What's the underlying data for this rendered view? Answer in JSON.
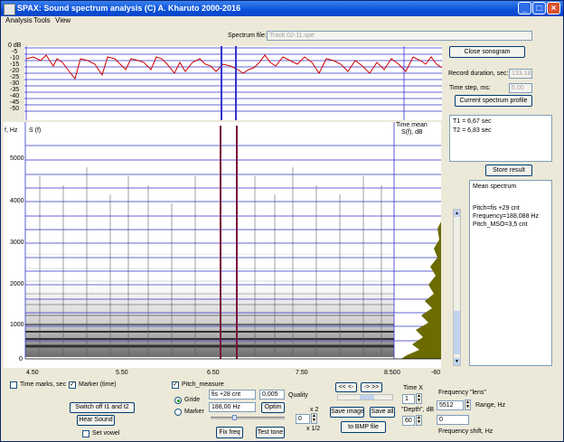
{
  "titlebar": {
    "title": "SPAX: Sound spectrum analysis    (C) A. Kharuto 2000-2016"
  },
  "menu": [
    "Analysis",
    "Tools",
    "View"
  ],
  "spectrum_file": {
    "label": "Spectrum file:",
    "value": "Track 02-11.spe"
  },
  "buttons": {
    "close_sonogram": "Close sonogram",
    "current_profile": "Current spectrum profile",
    "store_result": "Store result",
    "switch_off": "Switch off t1 and t2",
    "hear_sound": "Hear Sound",
    "fix_freq": "Fix freq",
    "test_tone": "Test tone",
    "optim": "Optim",
    "save_image": "Save image",
    "save_all": "Save all",
    "to_bmp": "to BMP file"
  },
  "record": {
    "duration_label": "Record duration, sec:",
    "duration_value": "133.18",
    "step_label": "Time step, ms:",
    "step_value": "5.00"
  },
  "t_info": {
    "t1": "T1 = 6,67 sec",
    "t2": "T2 = 6,83 sec"
  },
  "mean_spectrum": {
    "title": "Mean spectrum",
    "pitch": "Pitch=fis  +29 cnt",
    "frequency": "Frequency=188,088 Hz",
    "mso": "Pitch_MSO=3,5 cnt"
  },
  "top_plot": {
    "y_labels": [
      "0 dB",
      "-5",
      "-10",
      "-15",
      "-20",
      "-25",
      "-30",
      "-35",
      "-40",
      "-45",
      "-50"
    ]
  },
  "sonogram": {
    "hz_label": "f, Hz",
    "s_label": "S (f)",
    "time_mean": "Time mean",
    "sf_db": "S(f), dB",
    "y_labels": [
      "5000",
      "4000",
      "3000",
      "2000",
      "1000",
      "0"
    ],
    "x_labels": [
      "4.50",
      "5.50",
      "6.50",
      "7.50",
      "8.50"
    ],
    "mean_x_labels": [
      "0",
      "-60"
    ]
  },
  "controls": {
    "time_marks": "Time marks, sec",
    "marker_time": "Marker (time)",
    "set_vowel": "Set vowel",
    "pitch_measure": "Pitch_measure",
    "gride": "Gride",
    "marker": "Marker",
    "pitch_note": "fis +28 cnt",
    "pitch_hz": "188,00 Hz",
    "quality_val": "0,005",
    "quality_label": "Quality",
    "zoom_val": "0",
    "x2": "x 2",
    "x12": "x 1/2",
    "nav_rew": "<< <-",
    "nav_fwd": "-> >>",
    "time_x_label": "Time X",
    "time_x_val": "1",
    "depth_label": "\"Depth\", dB",
    "depth_val": "60",
    "freq_lens_label": "Frequency \"lens\"",
    "range_val": "5512",
    "range_label": "Range, Hz",
    "shift_val": "0",
    "shift_label": "Frequency shift, Hz"
  },
  "colors": {
    "grid": "#3333cc",
    "marker_t1": "#7a0f3a",
    "trace": "#cc0000",
    "mean_fill": "#6b6b00"
  }
}
